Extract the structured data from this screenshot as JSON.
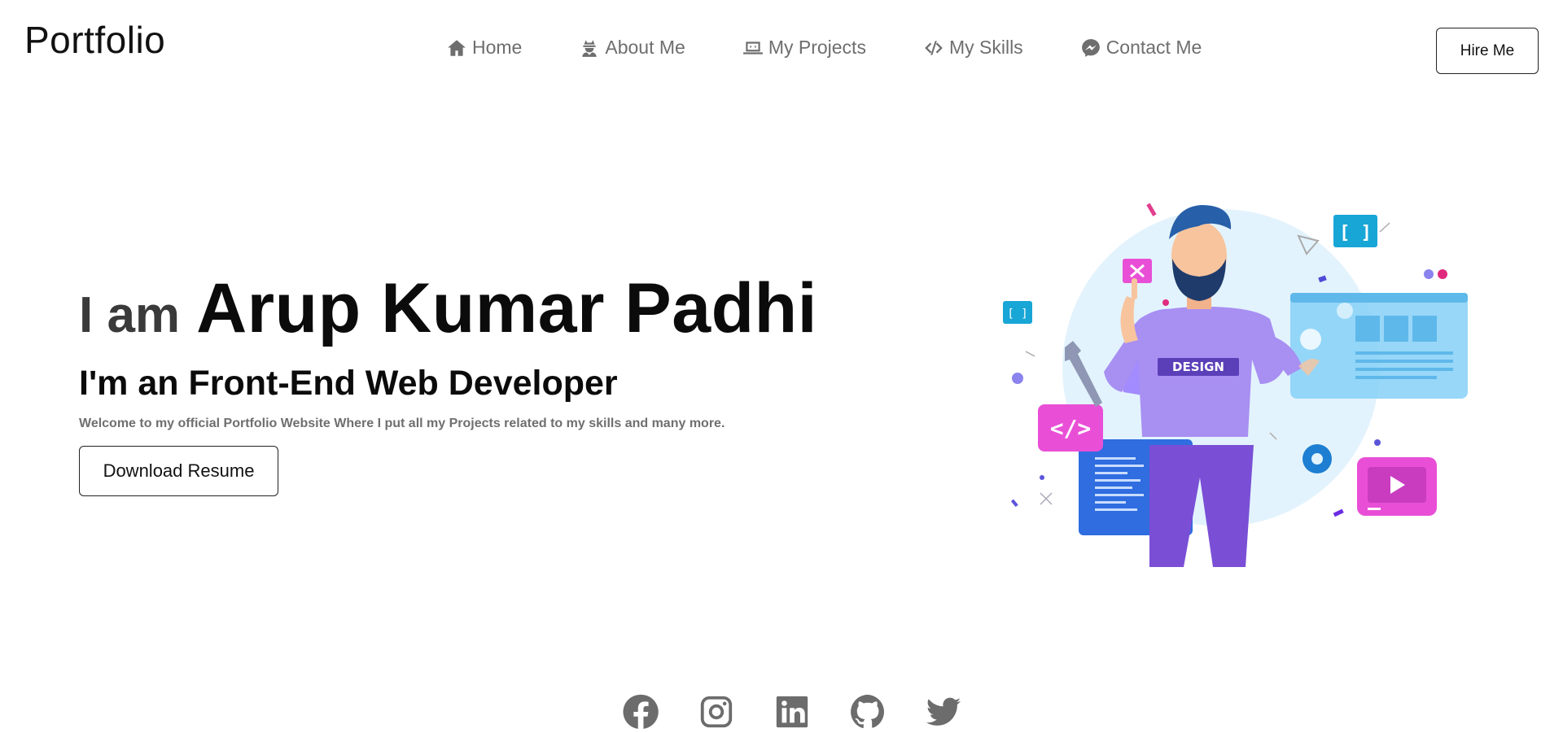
{
  "brand": {
    "logo": "Portfolio"
  },
  "nav": {
    "items": [
      {
        "label": "Home",
        "icon": "home-icon"
      },
      {
        "label": "About Me",
        "icon": "user-secret-icon"
      },
      {
        "label": "My Projects",
        "icon": "laptop-code-icon"
      },
      {
        "label": "My Skills",
        "icon": "code-icon"
      },
      {
        "label": "Contact Me",
        "icon": "messenger-icon"
      }
    ],
    "hire_label": "Hire Me"
  },
  "hero": {
    "greeting": "I am",
    "name": "Arup Kumar Padhi",
    "role": "I'm an Front-End Web Developer",
    "welcome": "Welcome to my official Portfolio Website Where I put all my Projects related to my skills and many more.",
    "download_label": "Download Resume"
  },
  "illustration": {
    "badge_text": "DESIGN",
    "code_tag": "</>",
    "bracket_text": "[ ]"
  },
  "socials": [
    {
      "icon": "facebook-icon"
    },
    {
      "icon": "instagram-icon"
    },
    {
      "icon": "linkedin-icon"
    },
    {
      "icon": "github-icon"
    },
    {
      "icon": "twitter-icon"
    }
  ],
  "colors": {
    "text_dark": "#0b0b0b",
    "text_muted": "#6e6e6e",
    "accent_purple": "#a28bff",
    "accent_pink": "#e94fd6",
    "accent_blue": "#2f8cf3",
    "accent_cyan": "#18a6d6"
  }
}
